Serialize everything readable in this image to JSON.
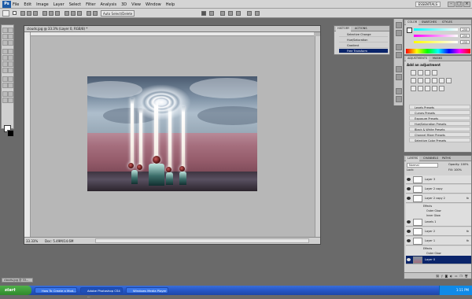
{
  "app": {
    "logo": "Ps",
    "menus": [
      "File",
      "Edit",
      "Image",
      "Layer",
      "Select",
      "Filter",
      "Analysis",
      "3D",
      "View",
      "Window",
      "Help"
    ],
    "workspace": "ESSENTIALS",
    "window_buttons": [
      "–",
      "□",
      "×"
    ]
  },
  "options_bar": {
    "auto_select_label": "Auto Select/Delete"
  },
  "document": {
    "title": "clouds.jpg @ 33.3% (Layer 0, RGB/8) *",
    "zoom": "33.33%",
    "doc_info": "Doc: 5.49M/14.6M"
  },
  "history_panel": {
    "tabs": [
      "HISTORY",
      "ACTIONS"
    ],
    "items": [
      "Selective Change",
      "Hue/Saturation",
      "Gradient",
      "Free Transform"
    ]
  },
  "color_panel": {
    "tabs": [
      "COLOR",
      "SWATCHES",
      "STYLES"
    ],
    "values": [
      "255",
      "255",
      "255"
    ]
  },
  "adjustments_panel": {
    "tabs": [
      "ADJUSTMENTS",
      "MASKS"
    ],
    "title": "Add an adjustment",
    "presets": [
      "Levels Presets",
      "Curves Presets",
      "Exposure Presets",
      "Hue/Saturation Presets",
      "Black & White Presets",
      "Channel Mixer Presets",
      "Selective Color Presets"
    ]
  },
  "layers_panel": {
    "tabs": [
      "LAYERS",
      "CHANNELS",
      "PATHS"
    ],
    "blend_mode": "Normal",
    "opacity": "Opacity: 100%",
    "lock": "Lock:",
    "fill": "Fill: 100%",
    "layers": [
      {
        "name": "Layer 3",
        "fx": ""
      },
      {
        "name": "Layer 2 copy",
        "fx": ""
      },
      {
        "name": "Layer 2 copy 2",
        "fx": "fx"
      },
      {
        "name": "Effects",
        "fx": ""
      },
      {
        "name": "Outer Glow",
        "fx": ""
      },
      {
        "name": "Inner Glow",
        "fx": ""
      },
      {
        "name": "Levels 1",
        "fx": ""
      },
      {
        "name": "Layer 2",
        "fx": "fx"
      },
      {
        "name": "Layer 1",
        "fx": "fx"
      },
      {
        "name": "Effects",
        "fx": ""
      },
      {
        "name": "Outer Glow",
        "fx": ""
      },
      {
        "name": "Layer 0",
        "fx": ""
      }
    ],
    "footer_icons": [
      "link",
      "fx",
      "mask",
      "adj",
      "group",
      "new",
      "trash"
    ]
  },
  "minimized_doc": "clouds.jpg @ 33...",
  "taskbar": {
    "start": "start",
    "items": [
      "How To Create a Mod...",
      "Adobe Photoshop CS4 ...",
      "Windows Media Player"
    ],
    "clock": "1:11 PM"
  },
  "colors": {
    "accent": "#0a246a",
    "taskbar": "#2456c8",
    "start": "#3f9a3a"
  }
}
